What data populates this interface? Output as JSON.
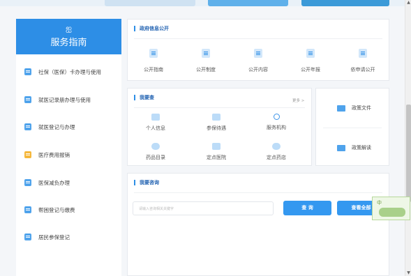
{
  "sidebar": {
    "head_icon": "service-guide-icon",
    "title": "服务指南",
    "items": [
      {
        "label": "社保（医保）卡办理与使用",
        "icon": "card-icon"
      },
      {
        "label": "就医记录册办理与使用",
        "icon": "record-book-icon"
      },
      {
        "label": "就医登记与办理",
        "icon": "register-icon"
      },
      {
        "label": "医疗费用报销",
        "icon": "reimburse-icon"
      },
      {
        "label": "医保减负办理",
        "icon": "reduce-burden-icon"
      },
      {
        "label": "帮困登记与缴费",
        "icon": "payment-icon"
      },
      {
        "label": "居民参保登记",
        "icon": "resident-icon"
      }
    ]
  },
  "gov_info": {
    "title": "政府信息公开",
    "items": [
      {
        "label": "公开指南",
        "icon": "guide-doc-icon"
      },
      {
        "label": "公开制度",
        "icon": "system-doc-icon"
      },
      {
        "label": "公开内容",
        "icon": "content-doc-icon"
      },
      {
        "label": "公开年报",
        "icon": "annual-report-icon"
      },
      {
        "label": "依申请公开",
        "icon": "apply-edit-icon"
      }
    ]
  },
  "wo_yao_cha": {
    "title": "我要查",
    "more": "更多 >",
    "items": [
      {
        "label": "个人信息",
        "icon": "person-card-icon"
      },
      {
        "label": "参保待遇",
        "icon": "benefit-icon"
      },
      {
        "label": "服务机构",
        "icon": "headset-icon"
      },
      {
        "label": "药品目录",
        "icon": "pill-icon"
      },
      {
        "label": "定点医院",
        "icon": "hospital-icon"
      },
      {
        "label": "定点药店",
        "icon": "pharmacy-icon"
      }
    ]
  },
  "right_box": {
    "items": [
      {
        "label": "政策文件",
        "icon": "folder-icon"
      },
      {
        "label": "政策解读",
        "icon": "policy-read-icon"
      }
    ]
  },
  "consult": {
    "title": "我要咨询",
    "search_placeholder": "请输入咨询相关关键字",
    "query_button": "查 询",
    "view_all_button": "查看全部"
  },
  "float_ad": {
    "label": "中"
  }
}
